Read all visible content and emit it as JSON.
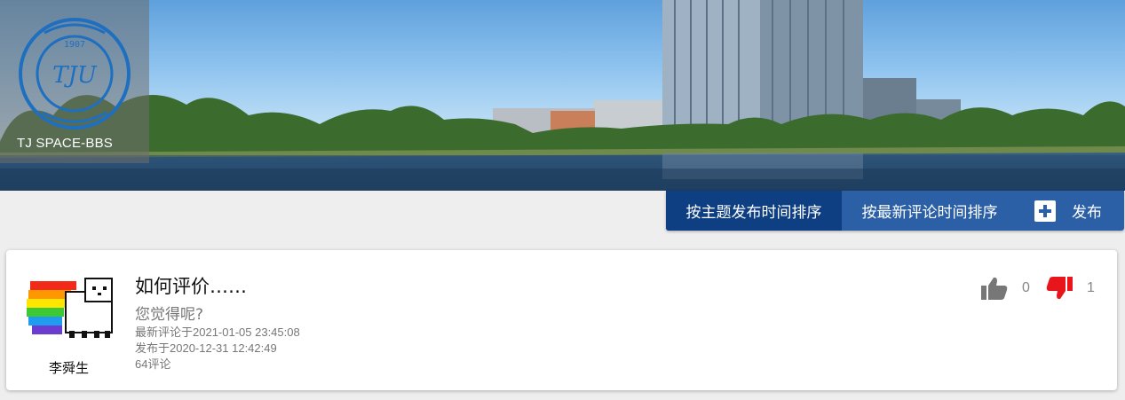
{
  "site": {
    "name": "TJ SPACE-BBS"
  },
  "toolbar": {
    "sort_by_post_time": "按主题发布时间排序",
    "sort_by_latest_comment": "按最新评论时间排序",
    "post_label": "发布"
  },
  "posts": [
    {
      "author": "李舜生",
      "title": "如何评价……",
      "summary": "您觉得呢?",
      "latest_comment": "最新评论于2021-01-05 23:45:08",
      "published": "发布于2020-12-31 12:42:49",
      "comments": "64评论",
      "likes": "0",
      "dislikes": "1"
    }
  ],
  "colors": {
    "toolbar": "#2b5fa6",
    "toolbar_active": "#0d3f82",
    "dislike": "#e8151b",
    "like": "#777777"
  },
  "icons": {
    "post": "add-box-icon",
    "like": "thumb-up-icon",
    "dislike": "thumb-down-icon",
    "logo": "tongji-university-seal"
  }
}
